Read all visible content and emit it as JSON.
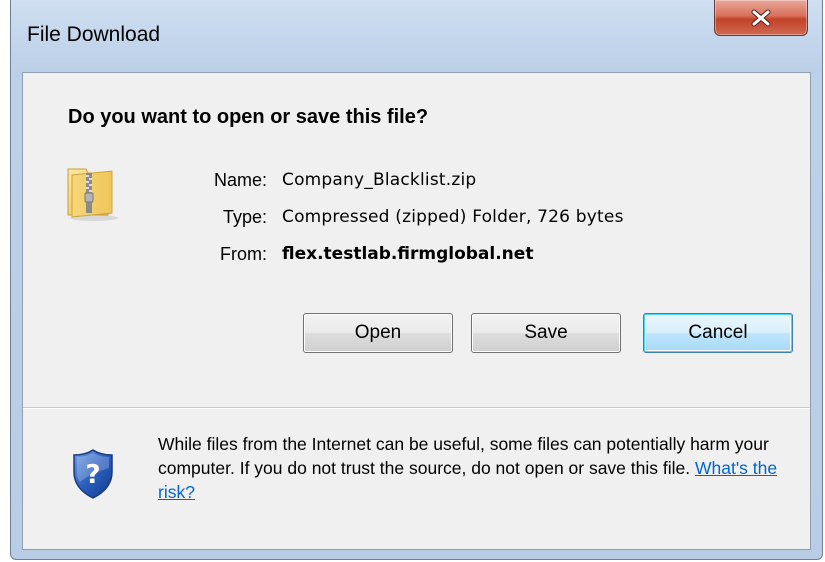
{
  "window": {
    "title": "File Download",
    "close_icon": "close-x-icon",
    "close_color": "#c7432c"
  },
  "dialog": {
    "question": "Do you want to open or save this file?",
    "file_icon": "zipped-folder-icon",
    "fields": {
      "name_label": "Name:",
      "name_value": "Company_Blacklist.zip",
      "type_label": "Type:",
      "type_value": "Compressed (zipped) Folder, 726 bytes",
      "from_label": "From:",
      "from_value": "flex.testlab.firmglobal.net"
    },
    "buttons": {
      "open": "Open",
      "save": "Save",
      "cancel": "Cancel"
    }
  },
  "warning": {
    "icon": "security-shield-question-icon",
    "text": "While files from the Internet can be useful, some files can potentially harm your computer. If you do not trust the source, do not open or save this file. ",
    "link": "What's the risk?",
    "link_color": "#0066cc"
  }
}
